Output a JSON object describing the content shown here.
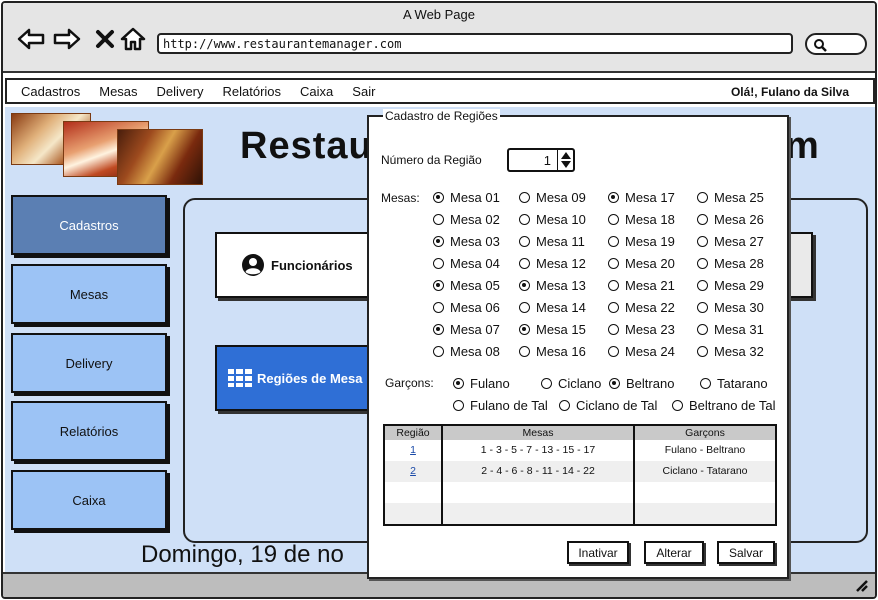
{
  "window": {
    "title": "A Web Page",
    "url": "http://www.restaurantemanager.com"
  },
  "menu": {
    "items": [
      "Cadastros",
      "Mesas",
      "Delivery",
      "Relatórios",
      "Caixa",
      "Sair"
    ],
    "greeting": "Olá!, Fulano da Silva"
  },
  "banner": {
    "brand_start": "Restau",
    "brand_end": "m"
  },
  "sidebar": {
    "items": [
      {
        "label": "Cadastros",
        "active": true
      },
      {
        "label": "Mesas",
        "active": false
      },
      {
        "label": "Delivery",
        "active": false
      },
      {
        "label": "Relatórios",
        "active": false
      },
      {
        "label": "Caixa",
        "active": false
      }
    ]
  },
  "cards": {
    "funcionarios": "Funcionários",
    "regioes": "Regiões de Mesa"
  },
  "footer": {
    "date": "Domingo, 19 de no"
  },
  "dialog": {
    "title": "Cadastro de Regiões",
    "region_number_label": "Número da Região",
    "region_number_value": "1",
    "tables_label": "Mesas:",
    "tables": [
      {
        "label": "Mesa 01",
        "checked": true
      },
      {
        "label": "Mesa 02",
        "checked": false
      },
      {
        "label": "Mesa 03",
        "checked": true
      },
      {
        "label": "Mesa 04",
        "checked": false
      },
      {
        "label": "Mesa 05",
        "checked": true
      },
      {
        "label": "Mesa 06",
        "checked": false
      },
      {
        "label": "Mesa 07",
        "checked": true
      },
      {
        "label": "Mesa 08",
        "checked": false
      },
      {
        "label": "Mesa 09",
        "checked": false
      },
      {
        "label": "Mesa 10",
        "checked": false
      },
      {
        "label": "Mesa 11",
        "checked": false
      },
      {
        "label": "Mesa 12",
        "checked": false
      },
      {
        "label": "Mesa 13",
        "checked": true
      },
      {
        "label": "Mesa 14",
        "checked": false
      },
      {
        "label": "Mesa 15",
        "checked": true
      },
      {
        "label": "Mesa 16",
        "checked": false
      },
      {
        "label": "Mesa 17",
        "checked": true
      },
      {
        "label": "Mesa 18",
        "checked": false
      },
      {
        "label": "Mesa 19",
        "checked": false
      },
      {
        "label": "Mesa 20",
        "checked": false
      },
      {
        "label": "Mesa 21",
        "checked": false
      },
      {
        "label": "Mesa 22",
        "checked": false
      },
      {
        "label": "Mesa 23",
        "checked": false
      },
      {
        "label": "Mesa 24",
        "checked": false
      },
      {
        "label": "Mesa 25",
        "checked": false
      },
      {
        "label": "Mesa 26",
        "checked": false
      },
      {
        "label": "Mesa 27",
        "checked": false
      },
      {
        "label": "Mesa 28",
        "checked": false
      },
      {
        "label": "Mesa 29",
        "checked": false
      },
      {
        "label": "Mesa 30",
        "checked": false
      },
      {
        "label": "Mesa 31",
        "checked": false
      },
      {
        "label": "Mesa 32",
        "checked": false
      }
    ],
    "waiters_label": "Garçons:",
    "waiters": [
      {
        "label": "Fulano",
        "checked": true
      },
      {
        "label": "Ciclano",
        "checked": false
      },
      {
        "label": "Beltrano",
        "checked": true
      },
      {
        "label": "Tatarano",
        "checked": false
      },
      {
        "label": "Fulano de Tal",
        "checked": false
      },
      {
        "label": "Ciclano de Tal",
        "checked": false
      },
      {
        "label": "Beltrano de Tal",
        "checked": false
      }
    ],
    "table": {
      "headers": [
        "Região",
        "Mesas",
        "Garçons"
      ],
      "rows": [
        {
          "region": "1",
          "tables": "1 - 3 - 5 - 7 - 13 - 15 - 17",
          "waiters": "Fulano - Beltrano"
        },
        {
          "region": "2",
          "tables": "2 - 4 - 6 - 8 - 11 - 14 - 22",
          "waiters": "Ciclano - Tatarano"
        }
      ]
    },
    "buttons": {
      "deactivate": "Inativar",
      "edit": "Alterar",
      "save": "Salvar"
    }
  },
  "colors": {
    "accent_blue": "#2f6fd6",
    "side_button": "#9cc3f5",
    "side_active": "#5b7fb3",
    "panel_bg": "#cfe0f7"
  }
}
